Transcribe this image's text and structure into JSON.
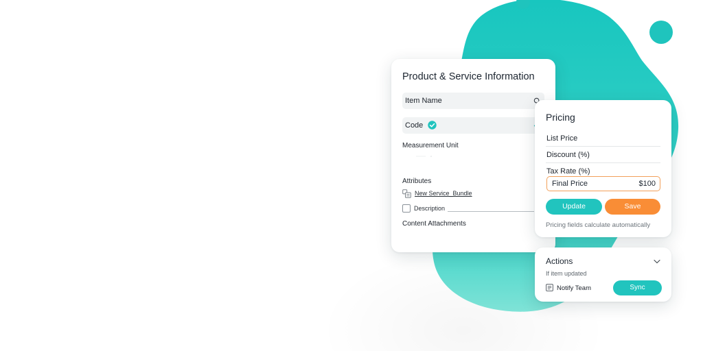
{
  "product_card": {
    "title": "Product & Service Information",
    "item_name_label": "Item Name",
    "code_label": "Code",
    "measurement_unit_label": "Measurement Unit",
    "attributes_label": "Attributes",
    "bundle_link": "New Service_Bundle",
    "description_label": "Description",
    "content_attachments_label": "Content Attachments"
  },
  "pricing_card": {
    "title": "Pricing",
    "list_price_label": "List Price",
    "discount_label": "Discount (%)",
    "tax_rate_label": "Tax Rate (%)",
    "final_price_label": "Final Price",
    "final_price_value": "$100",
    "update_label": "Update",
    "save_label": "Save",
    "note": "Pricing fields calculate automatically"
  },
  "actions_card": {
    "title": "Actions",
    "subtitle": "If item updated",
    "notify_label": "Notify Team",
    "sync_label": "Sync"
  },
  "colors": {
    "accent_teal": "#21c4be",
    "accent_orange": "#f98d36",
    "blob_teal": "#22c9c1",
    "highlight_border": "#f2a05a"
  },
  "icons": [
    "search-icon",
    "check-circle-icon",
    "check-icon",
    "bundle-icon",
    "checkbox-icon",
    "chevron-down-icon",
    "note-icon"
  ]
}
